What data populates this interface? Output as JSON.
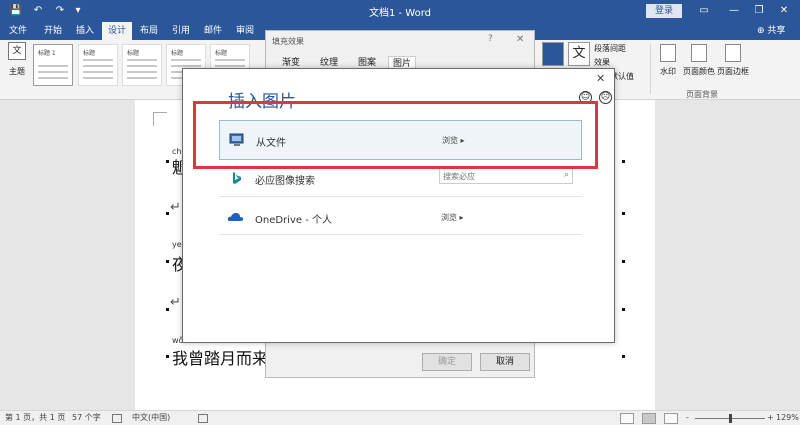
{
  "window": {
    "title": "文档1 - Word",
    "login": "登录",
    "controls": [
      "▭",
      "—",
      "❐",
      "✕"
    ]
  },
  "quick_access": {
    "save": "💾",
    "undo": "↶",
    "redo": "↷",
    "more": "▾"
  },
  "tabs": [
    "文件",
    "开始",
    "插入",
    "设计",
    "布局",
    "引用",
    "邮件",
    "审阅"
  ],
  "active_tab": "设计",
  "share": "⊕ 共享",
  "ribbon": {
    "theme": "主题",
    "style_thumbs": [
      "标题",
      "标题 1",
      "标题",
      "标题",
      "标题",
      "标题",
      "标题"
    ],
    "paragraph_spacing": "段落间距",
    "effects": "效果",
    "set_default": "默认值",
    "watermark": "水印",
    "page_color": "页面颜色",
    "page_border": "页面边框",
    "group_page_bg": "页面背景",
    "wen_icon": "文"
  },
  "document": {
    "pinyin_1": "ch",
    "char_1": "魍",
    "pinyin_2": "ye",
    "char_2": "夜",
    "pinyin_3": "wǒ",
    "line_3": "我曾踏月而来",
    "para_mark": "↵"
  },
  "fill_dialog": {
    "title": "填充效果",
    "help": "?",
    "close": "✕",
    "tabs": [
      "渐变",
      "纹理",
      "图案",
      "图片"
    ],
    "active_tab": "图片",
    "ok": "确定",
    "cancel": "取消"
  },
  "insert_dialog": {
    "title": "插入图片",
    "close": "✕",
    "smile": "☺",
    "frown": "☹",
    "sources": [
      {
        "name": "从文件",
        "action": "浏览 ▸"
      },
      {
        "name": "必应图像搜索",
        "placeholder": "搜索必应"
      },
      {
        "name": "OneDrive - 个人",
        "action": "浏览 ▸"
      }
    ],
    "search_icon": "⌕"
  },
  "status": {
    "page": "第 1 页，共 1 页",
    "words": "57 个字",
    "lang": "中文(中国)",
    "zoom": "129%",
    "zoom_minus": "-",
    "zoom_plus": "+"
  },
  "colors": {
    "accent": "#2b579a",
    "highlight": "#e2363a"
  }
}
